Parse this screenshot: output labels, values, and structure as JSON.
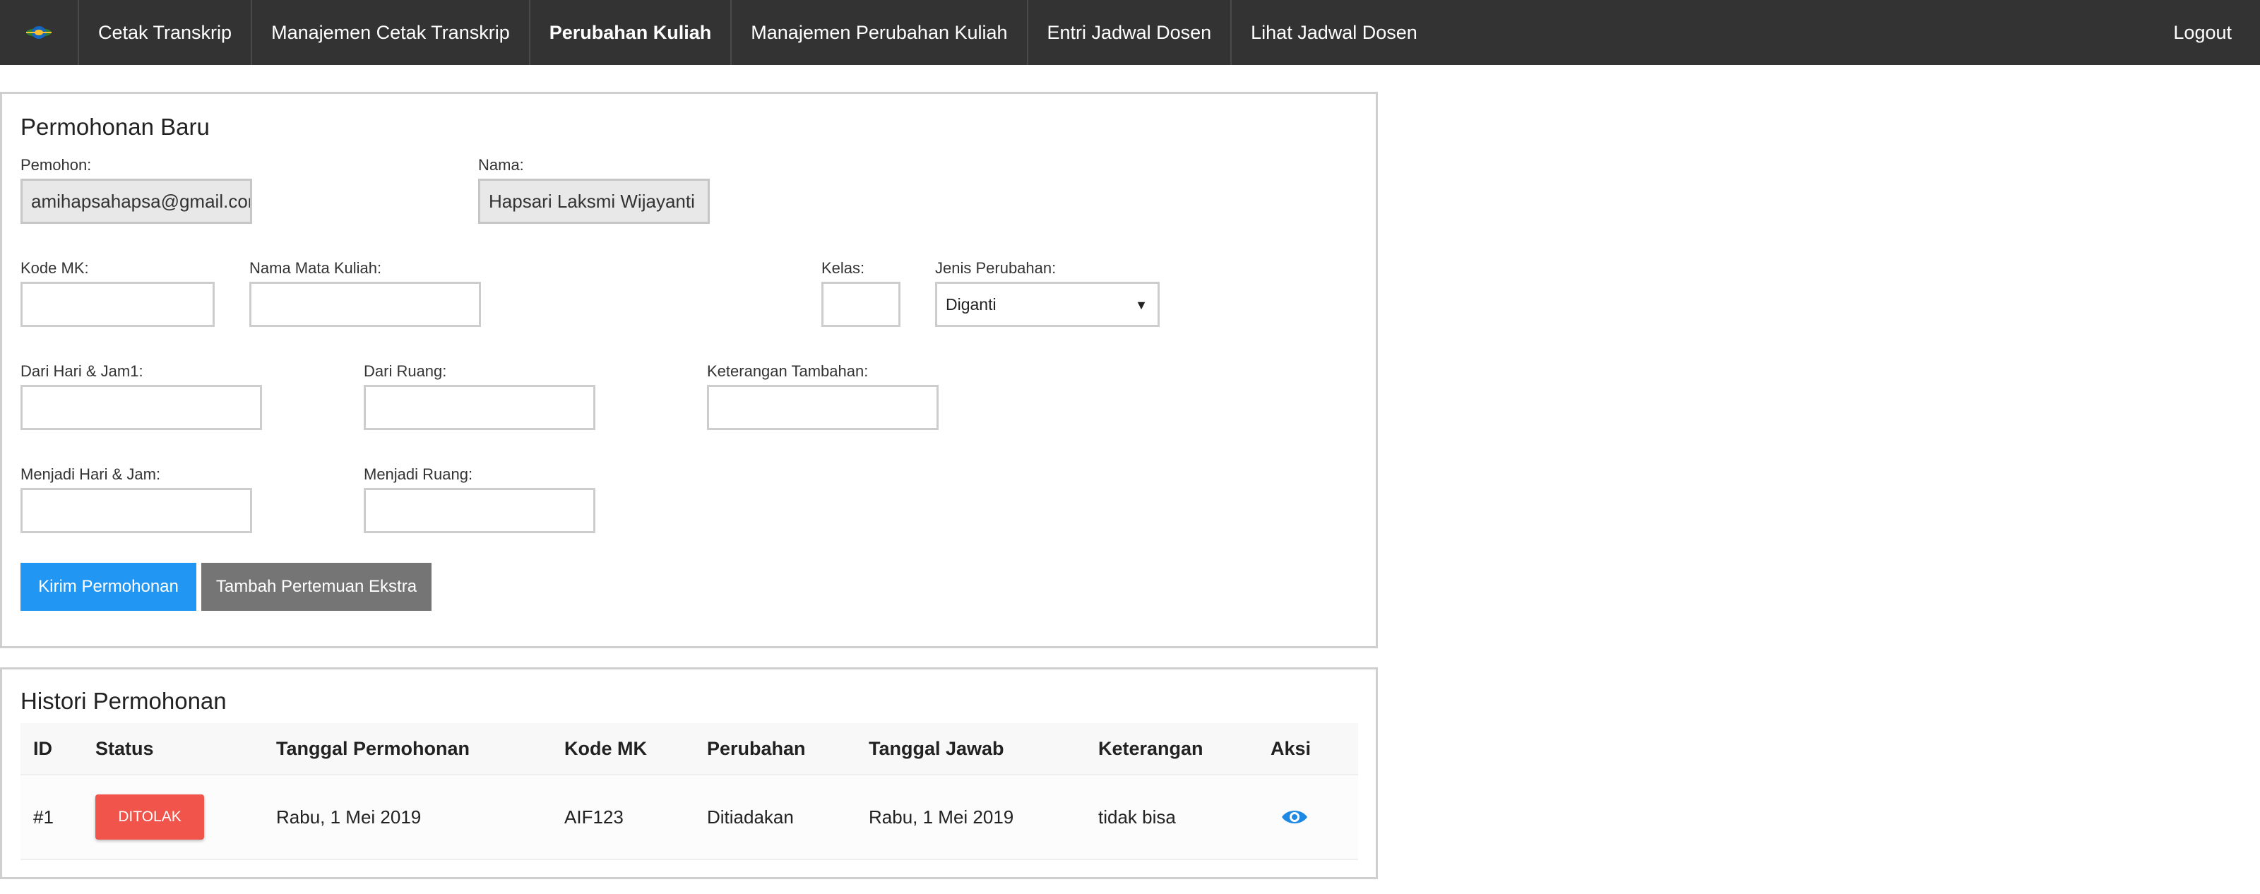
{
  "nav": {
    "items": [
      {
        "label": "Cetak Transkrip",
        "active": false
      },
      {
        "label": "Manajemen Cetak Transkrip",
        "active": false
      },
      {
        "label": "Perubahan Kuliah",
        "active": true
      },
      {
        "label": "Manajemen Perubahan Kuliah",
        "active": false
      },
      {
        "label": "Entri Jadwal Dosen",
        "active": false
      },
      {
        "label": "Lihat Jadwal Dosen",
        "active": false
      }
    ],
    "logout_label": "Logout",
    "logo_icon": "university-logo-icon"
  },
  "form": {
    "title": "Permohonan Baru",
    "pemohon": {
      "label": "Pemohon:",
      "value": "amihapsahapsa@gmail.com"
    },
    "nama": {
      "label": "Nama:",
      "value": "Hapsari Laksmi Wijayanti"
    },
    "kode_mk": {
      "label": "Kode MK:",
      "value": ""
    },
    "nama_mk": {
      "label": "Nama Mata Kuliah:",
      "value": ""
    },
    "kelas": {
      "label": "Kelas:",
      "value": ""
    },
    "jenis": {
      "label": "Jenis Perubahan:",
      "value": "Diganti"
    },
    "dari_hari": {
      "label": "Dari Hari & Jam1:",
      "value": ""
    },
    "dari_ruang": {
      "label": "Dari Ruang:",
      "value": ""
    },
    "keterangan": {
      "label": "Keterangan Tambahan:",
      "value": ""
    },
    "menjadi_hari": {
      "label": "Menjadi Hari & Jam:",
      "value": ""
    },
    "menjadi_ruang": {
      "label": "Menjadi Ruang:",
      "value": ""
    },
    "submit_label": "Kirim Permohonan",
    "extra_label": "Tambah Pertemuan Ekstra"
  },
  "history": {
    "title": "Histori Permohonan",
    "headers": [
      "ID",
      "Status",
      "Tanggal Permohonan",
      "Kode MK",
      "Perubahan",
      "Tanggal Jawab",
      "Keterangan",
      "Aksi"
    ],
    "rows": [
      {
        "id": "#1",
        "status": "DITOLAK",
        "tanggal_permohonan": "Rabu, 1 Mei 2019",
        "kode_mk": "AIF123",
        "perubahan": "Ditiadakan",
        "tanggal_jawab": "Rabu, 1 Mei 2019",
        "keterangan": "tidak bisa",
        "aksi_icon": "eye-icon"
      }
    ]
  },
  "colors": {
    "navbar": "#333333",
    "primary": "#2196f3",
    "secondary": "#757575",
    "danger": "#f0544a"
  }
}
